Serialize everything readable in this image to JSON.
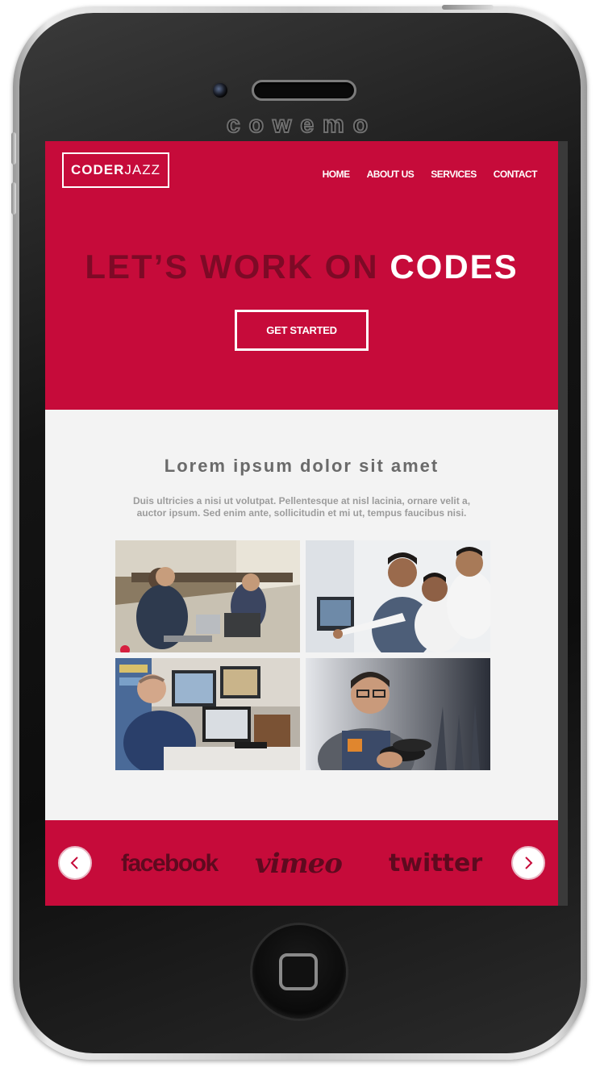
{
  "device": {
    "brand_mark": "cowemo"
  },
  "header": {
    "logo": {
      "bold": "CODER",
      "light": "JAZZ"
    },
    "nav": [
      {
        "label": "HOME"
      },
      {
        "label": "ABOUT US"
      },
      {
        "label": "SERVICES"
      },
      {
        "label": "CONTACT"
      }
    ]
  },
  "hero": {
    "headline_muted": "LET’S WORK ON",
    "headline_strong": "CODES",
    "cta_label": "GET STARTED"
  },
  "content": {
    "title": "Lorem ipsum dolor sit amet",
    "body": "Duis ultricies a nisi ut volutpat. Pellentesque at nisl lacinia, ornare velit a, auctor ipsum. Sed enim ante, sollicitudin et mi ut, tempus faucibus nisi.",
    "photos": [
      {
        "subject": "team-workspace-photo"
      },
      {
        "subject": "team-discussion-photo"
      },
      {
        "subject": "developer-desk-photo"
      },
      {
        "subject": "developer-phone-photo"
      }
    ]
  },
  "social": {
    "prev_icon": "chevron-left-icon",
    "next_icon": "chevron-right-icon",
    "logos": [
      {
        "label": "facebook"
      },
      {
        "label": "vimeo"
      },
      {
        "label": "twitter"
      }
    ],
    "accent": "#c60b3a",
    "logo_color": "#5e0a1f"
  },
  "colors": {
    "primary": "#c60b3a",
    "content_bg": "#f3f3f3"
  }
}
